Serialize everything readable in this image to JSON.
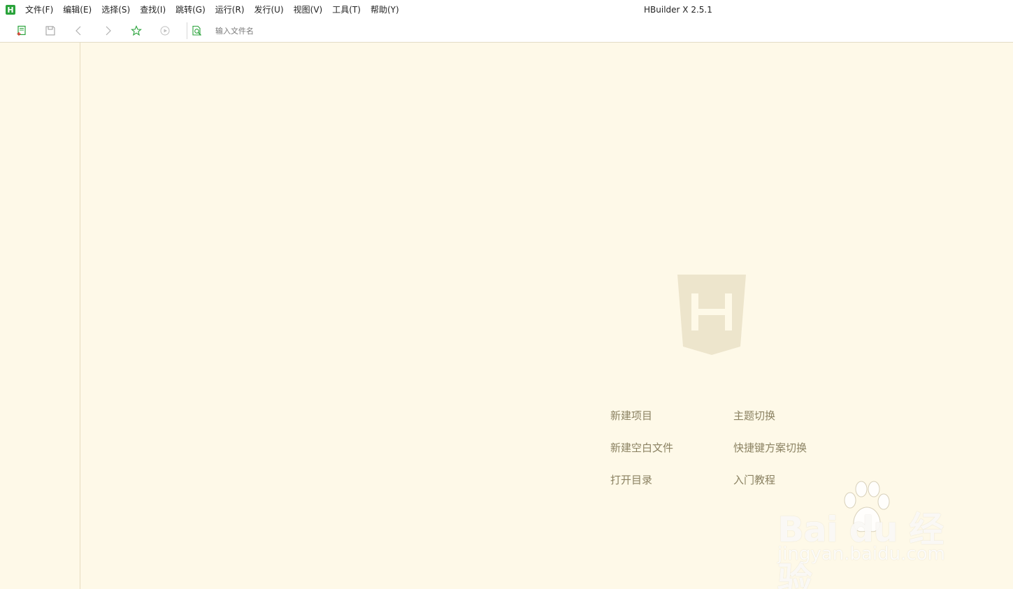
{
  "app": {
    "logo_letter": "H",
    "window_title": "HBuilder X 2.5.1"
  },
  "menu": [
    {
      "label": "文件(F)"
    },
    {
      "label": "编辑(E)"
    },
    {
      "label": "选择(S)"
    },
    {
      "label": "查找(I)"
    },
    {
      "label": "跳转(G)"
    },
    {
      "label": "运行(R)"
    },
    {
      "label": "发行(U)"
    },
    {
      "label": "视图(V)"
    },
    {
      "label": "工具(T)"
    },
    {
      "label": "帮助(Y)"
    }
  ],
  "toolbar": {
    "buttons": [
      {
        "icon": "new-file-icon"
      },
      {
        "icon": "save-icon"
      },
      {
        "icon": "back-icon"
      },
      {
        "icon": "forward-icon"
      },
      {
        "icon": "star-icon"
      },
      {
        "icon": "run-icon"
      }
    ],
    "file_search": {
      "icon": "file-search-icon",
      "placeholder": "输入文件名"
    }
  },
  "welcome": {
    "logo_letter": "H",
    "quick_actions": {
      "new_project": "新建项目",
      "new_blank_file": "新建空白文件",
      "open_directory": "打开目录",
      "theme_switch": "主题切换",
      "keymap_switch": "快捷键方案切换",
      "tutorial": "入门教程"
    }
  },
  "watermark": {
    "main": "Bai du 经验",
    "sub": "jingyan.baidu.com"
  },
  "colors": {
    "accent_green": "#2aa33b",
    "editor_bg": "#fef9e8",
    "shield": "#ede5cc",
    "action_text": "#8b8262"
  }
}
